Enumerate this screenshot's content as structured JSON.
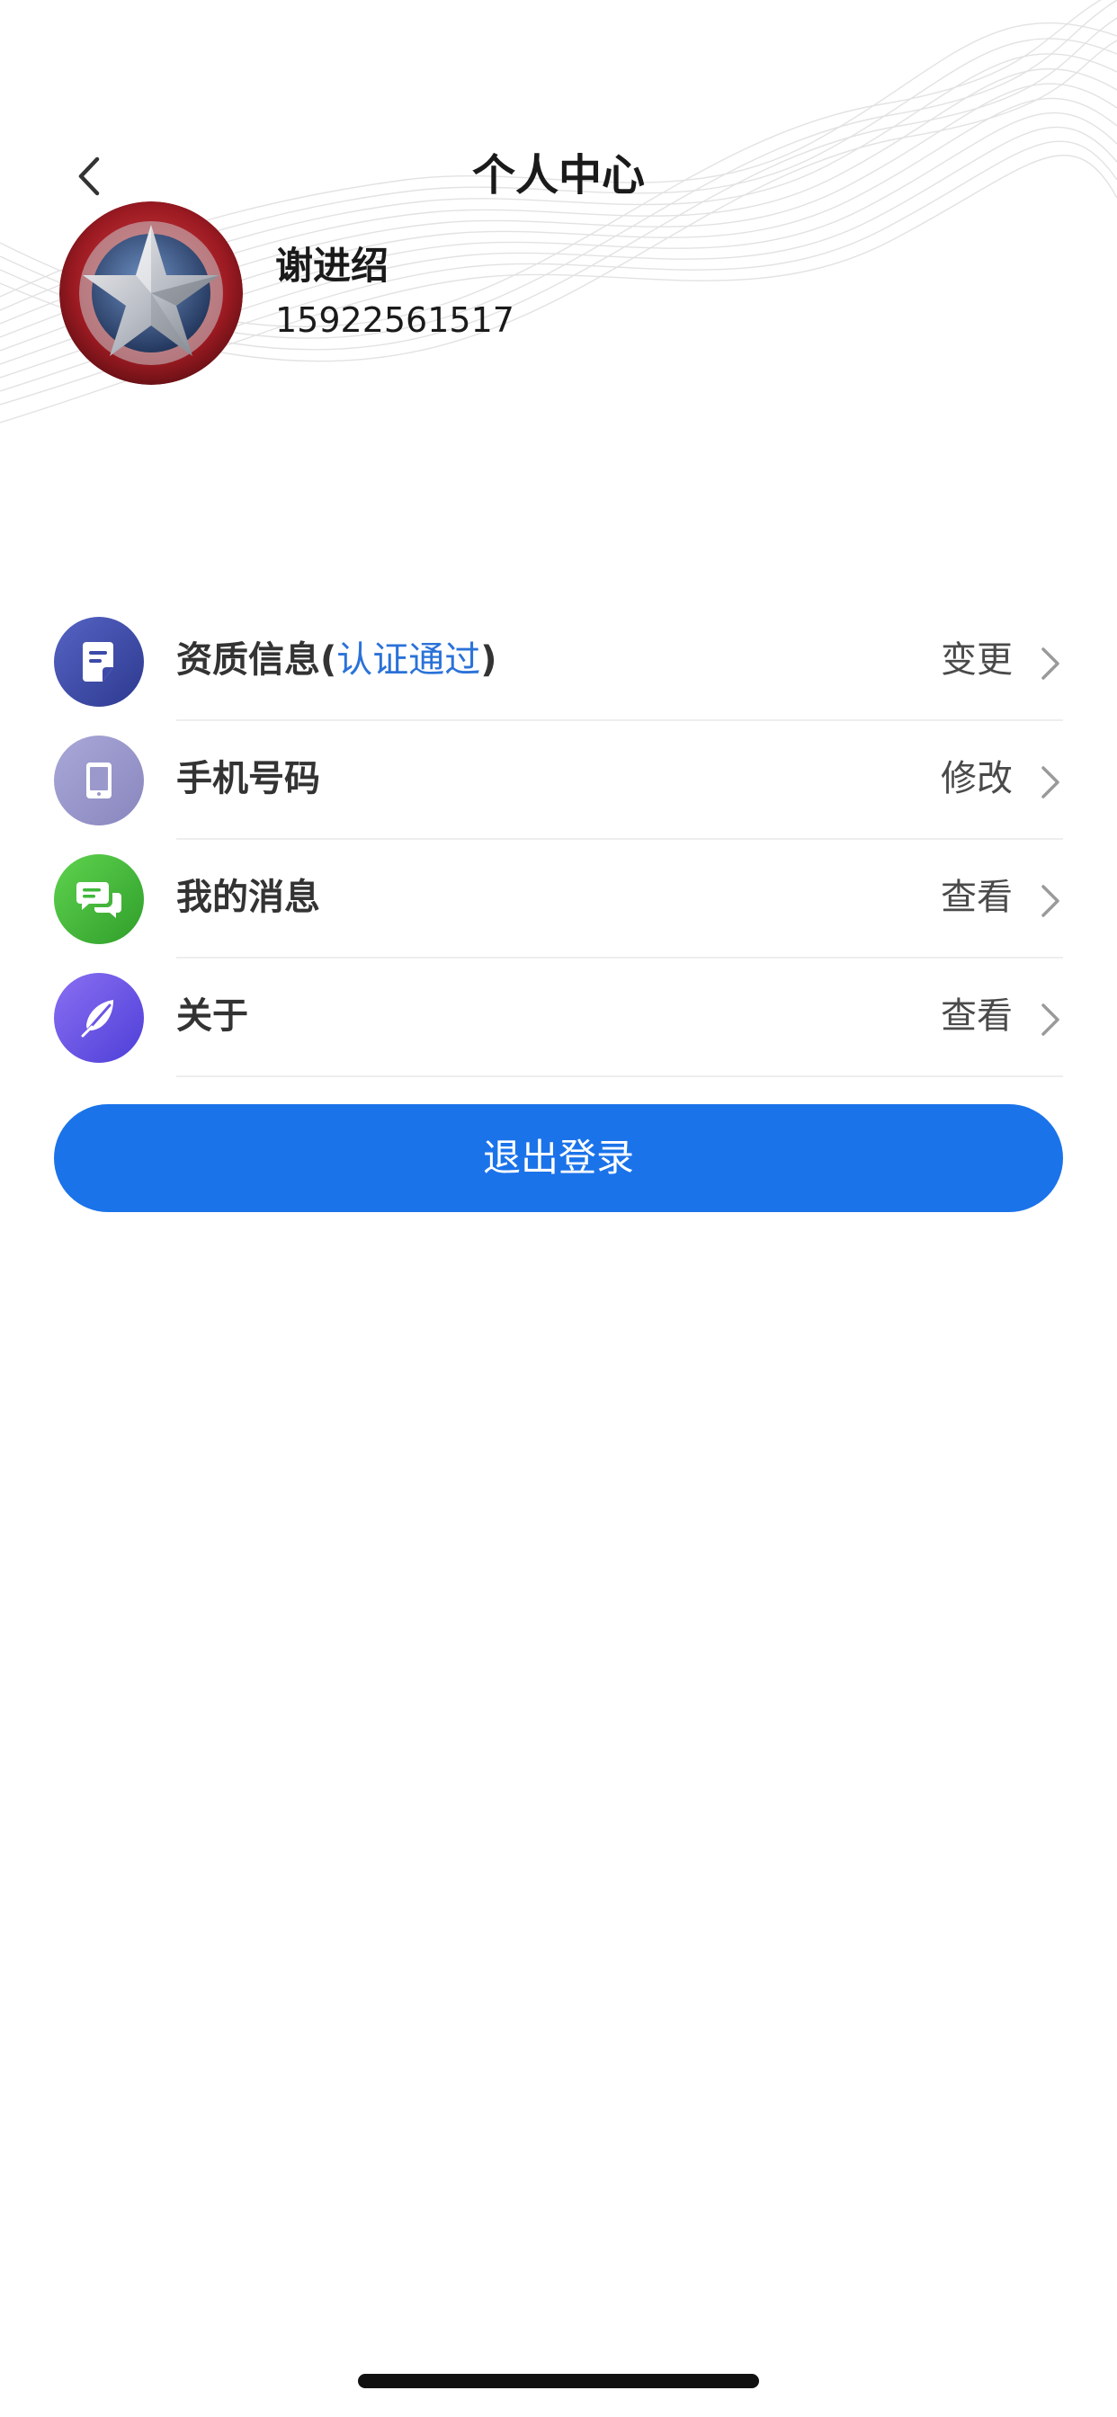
{
  "header": {
    "title": "个人中心",
    "back_icon": "chevron-left-icon"
  },
  "profile": {
    "name": "谢进绍",
    "phone": "15922561517",
    "avatar_icon": "shield-star-avatar"
  },
  "menu": {
    "items": [
      {
        "label": "资质信息",
        "status_open": "(",
        "status": "认证通过",
        "status_close": ")",
        "action": "变更",
        "icon": "document-icon",
        "icon_color": "#3d4aa8"
      },
      {
        "label": "手机号码",
        "action": "修改",
        "icon": "phone-device-icon",
        "icon_color": "#9b99cc"
      },
      {
        "label": "我的消息",
        "action": "查看",
        "icon": "chat-bubbles-icon",
        "icon_color": "#3fb83a"
      },
      {
        "label": "关于",
        "action": "查看",
        "icon": "feather-icon",
        "icon_color": "#6b55e8"
      }
    ]
  },
  "logout": {
    "label": "退出登录",
    "color": "#1b73ea"
  },
  "colors": {
    "status_link": "#2a72d8",
    "text_primary": "#1a1a1a"
  }
}
